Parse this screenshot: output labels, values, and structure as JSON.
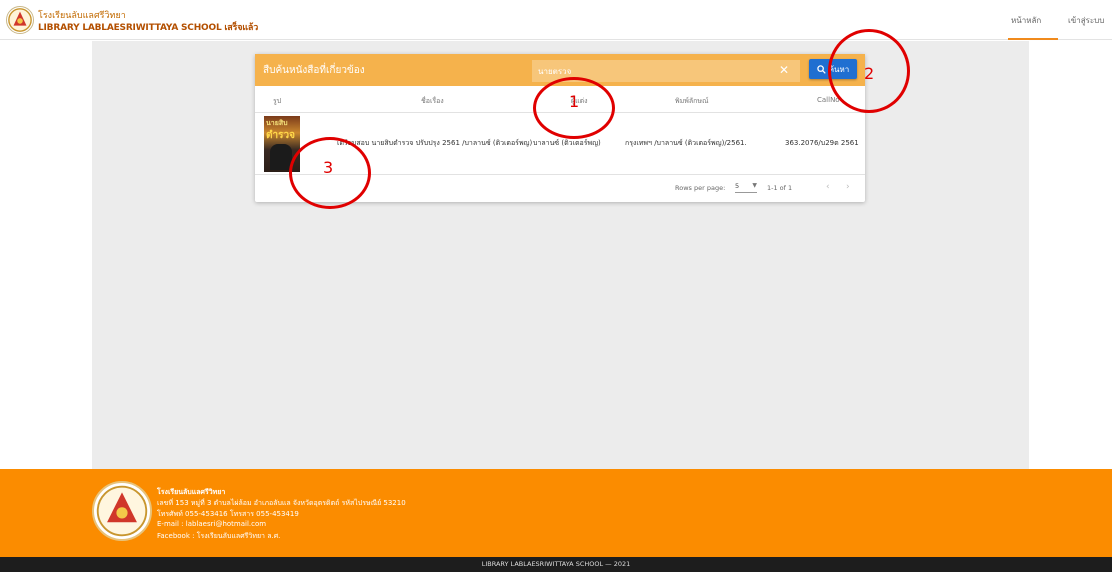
{
  "header": {
    "school_name_th": "โรงเรียนลับแลศรีวิทยา",
    "school_name_en": "LIBRARY LABLAESRIWITTAYA SCHOOL เสร็จแล้ว",
    "nav": {
      "home": "หน้าหลัก",
      "login": "เข้าสู่ระบบ"
    }
  },
  "card": {
    "title": "สืบค้นหนังสือที่เกี่ยวข้อง",
    "search": {
      "value": "นายตรวจ",
      "placeholder": ""
    },
    "clear_icon": "close-icon",
    "search_button_label": "ค้นหา",
    "columns": [
      "รูป",
      "ชื่อเรื่อง",
      "ผู้แต่ง",
      "พิมพ์ลักษณ์",
      "CallNo"
    ],
    "rows": [
      {
        "cover_title_1": "นายสิบ",
        "cover_title_2": "ตำรวจ",
        "title": "เตรียมสอบ นายสิบตำรวจ ปรับปรุง 2561 /บาลานซ์ (ติวเตอร์พญ)",
        "author": "บาลานซ์ (ติวเตอร์พญ)",
        "imprint": "กรุงเทพฯ /บาลานซ์ (ติวเตอร์พญ)/2561.",
        "call_no": "363.2076/บ29ต 2561"
      }
    ],
    "pagination": {
      "rows_per_page_label": "Rows per page:",
      "rows_per_page_value": "5",
      "range": "1-1 of 1"
    }
  },
  "annotations": [
    "1",
    "2",
    "3"
  ],
  "footer": {
    "lines": [
      "โรงเรียนลับแลศรีวิทยา",
      "เลขที่ 153 หมู่ที่ 3 ตำบลไผ่ล้อม อำเภอลับแล จังหวัดอุตรดิตถ์ รหัสไปรษณีย์ 53210",
      "โทรศัพท์ 055-453416 โทรสาร 055-453419",
      "E-mail : lablaesri@hotmail.com",
      "Facebook : โรงเรียนลับแลศรีวิทยา ล.ศ."
    ],
    "copyright": "LIBRARY LABLAESRIWITTAYA SCHOOL — 2021"
  },
  "colors": {
    "accent_orange": "#fb8c00",
    "card_header": "#f5b24c",
    "search_button": "#1f6fd1",
    "annotation_red": "#e00000"
  }
}
